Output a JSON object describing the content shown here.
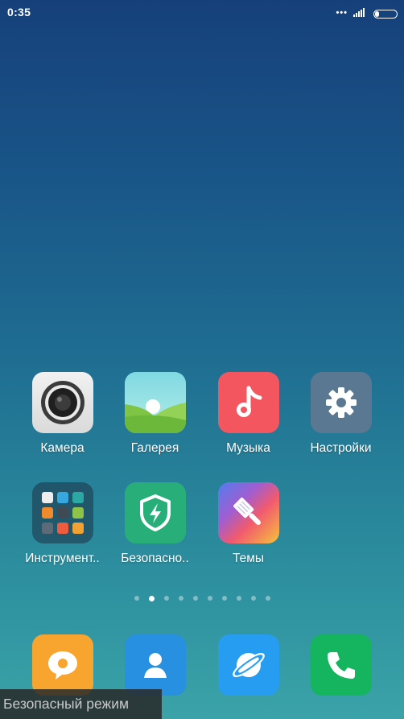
{
  "status_bar": {
    "time": "0:35",
    "dots": "•••",
    "icons": [
      "signal-icon",
      "battery-icon"
    ],
    "battery_level": 0.2
  },
  "apps_row1": [
    {
      "label": "Камера",
      "icon": "camera-icon"
    },
    {
      "label": "Галерея",
      "icon": "gallery-icon"
    },
    {
      "label": "Музыка",
      "icon": "music-icon"
    },
    {
      "label": "Настройки",
      "icon": "settings-gear-icon"
    }
  ],
  "apps_row2": [
    {
      "label": "Инструмент..",
      "icon": "tools-folder-icon"
    },
    {
      "label": "Безопасно..",
      "icon": "security-shield-icon"
    },
    {
      "label": "Темы",
      "icon": "themes-brush-icon"
    }
  ],
  "page_indicator": {
    "count": 10,
    "active": 2
  },
  "dock": [
    {
      "icon": "messages-icon"
    },
    {
      "icon": "contacts-icon"
    },
    {
      "icon": "browser-icon"
    },
    {
      "icon": "phone-icon"
    }
  ],
  "safe_mode_label": "Безопасный режим",
  "colors": {
    "music": "#f4565f",
    "settings": "#5a7892",
    "security": "#27ae79",
    "messages": "#f8a530",
    "contacts": "#2790e0",
    "browser": "#269df0",
    "phone": "#15b45e"
  }
}
